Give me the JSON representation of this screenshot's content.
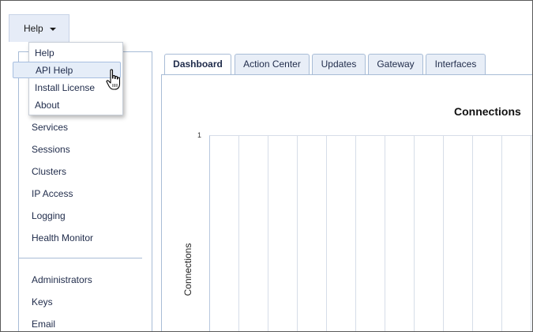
{
  "menu": {
    "button_label": "Help",
    "items": [
      {
        "label": "Help"
      },
      {
        "label": "API Help"
      },
      {
        "label": "Install License"
      },
      {
        "label": "About"
      }
    ]
  },
  "sidebar": {
    "items": [
      {
        "label": "Services"
      },
      {
        "label": "Sessions"
      },
      {
        "label": "Clusters"
      },
      {
        "label": "IP Access"
      },
      {
        "label": "Logging"
      },
      {
        "label": "Health Monitor"
      },
      {
        "label": "Administrators"
      },
      {
        "label": "Keys"
      },
      {
        "label": "Email"
      }
    ]
  },
  "tabs": [
    {
      "label": "Dashboard",
      "active": true
    },
    {
      "label": "Action Center"
    },
    {
      "label": "Updates"
    },
    {
      "label": "Gateway"
    },
    {
      "label": "Interfaces"
    }
  ],
  "chart_data": {
    "type": "line",
    "title": "Connections",
    "xlabel": "",
    "ylabel": "Connections",
    "y_ticks": [
      "1"
    ],
    "grid": true,
    "series": []
  },
  "colors": {
    "border": "#a8bcd6",
    "menu_highlight": "#e5edf8",
    "text": "#1f2b4a"
  }
}
